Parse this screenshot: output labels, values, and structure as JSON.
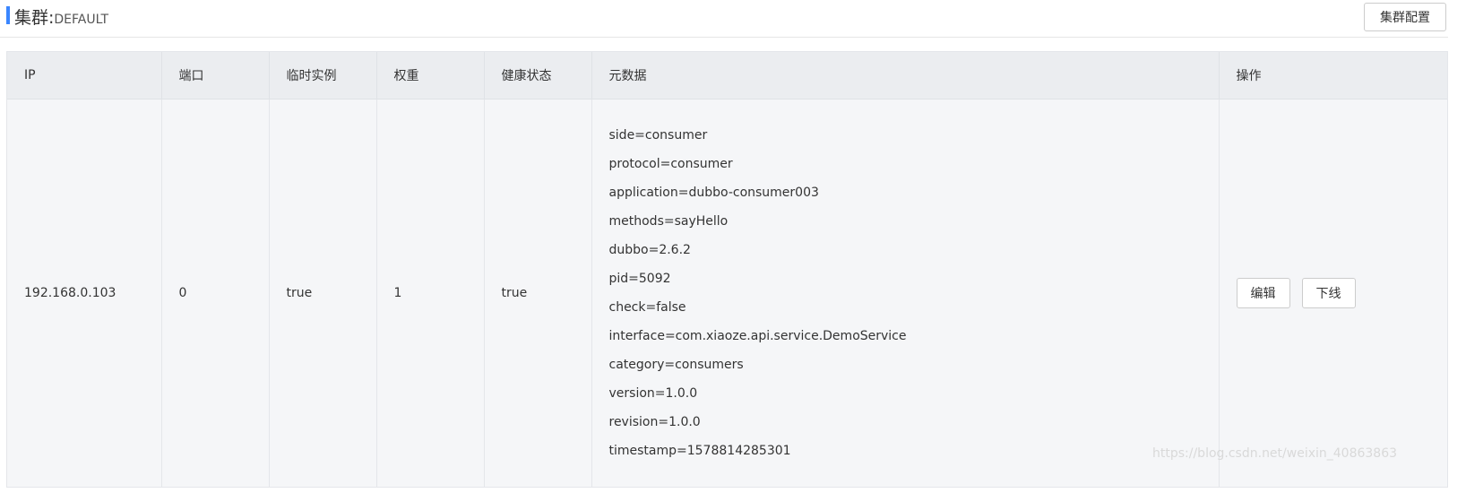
{
  "header": {
    "title_label": "集群:",
    "title_value": "DEFAULT",
    "config_button": "集群配置"
  },
  "table": {
    "columns": [
      "IP",
      "端口",
      "临时实例",
      "权重",
      "健康状态",
      "元数据",
      "操作"
    ],
    "row": {
      "ip": "192.168.0.103",
      "port": "0",
      "ephemeral": "true",
      "weight": "1",
      "healthy": "true",
      "metadata": [
        "side=consumer",
        "protocol=consumer",
        "application=dubbo-consumer003",
        "methods=sayHello",
        "dubbo=2.6.2",
        "pid=5092",
        "check=false",
        "interface=com.xiaoze.api.service.DemoService",
        "category=consumers",
        "version=1.0.0",
        "revision=1.0.0",
        "timestamp=1578814285301"
      ],
      "actions": {
        "edit": "编辑",
        "offline": "下线"
      }
    }
  },
  "watermark": "https://blog.csdn.net/weixin_40863863",
  "colors": {
    "accent": "#3a86ff",
    "header_bg": "#ebedf0",
    "row_bg": "#f5f6f8"
  }
}
